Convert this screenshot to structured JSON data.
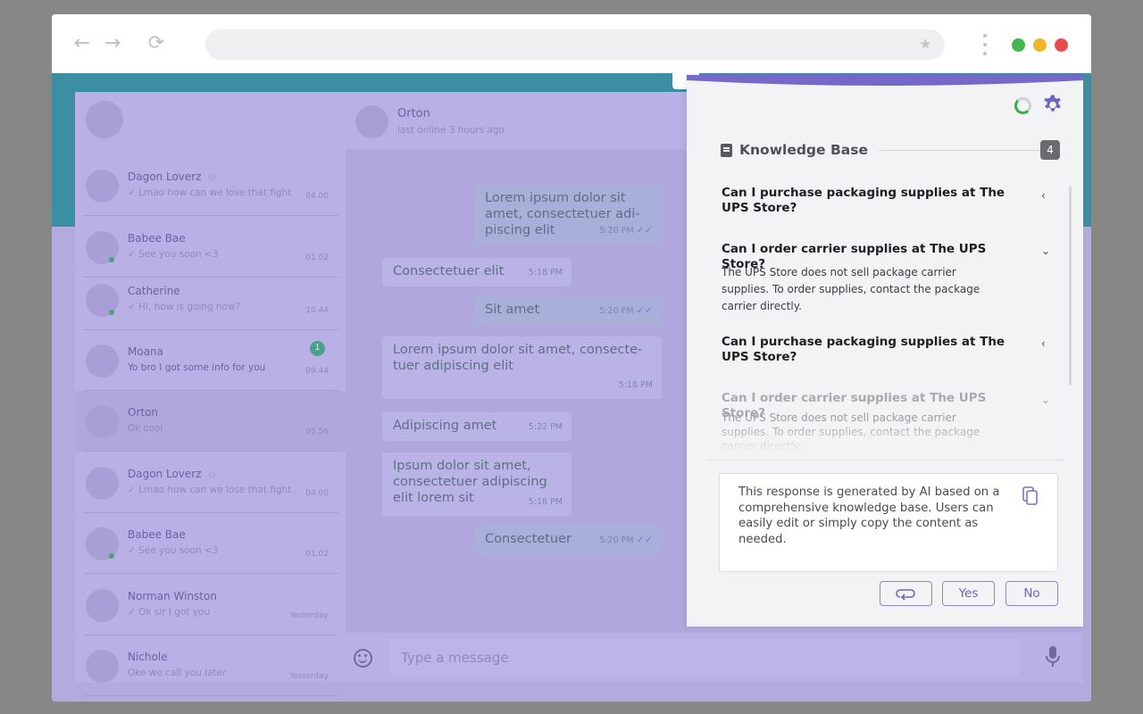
{
  "browser": {
    "back_glyph": "←",
    "forward_glyph": "→",
    "reload_glyph": "⟳",
    "star_glyph": "★",
    "traffic_lights": [
      "#41b84c",
      "#f1b52a",
      "#ea4a4e"
    ]
  },
  "chat_list": {
    "items": [
      {
        "name": "Dagon Loverz",
        "group": true,
        "message": "✓ Lmao how can we lose that fight",
        "time": "04.00",
        "online": false
      },
      {
        "name": "Babee Bae",
        "group": false,
        "message": "✓ See you soon <3",
        "time": "01.02",
        "online": true
      },
      {
        "name": "Catherine",
        "group": false,
        "message": "✓ Hi, how is going now?",
        "time": "10.44",
        "online": true
      },
      {
        "name": "Moana",
        "group": false,
        "message": "Yo bro I got some info for you",
        "time": "09.44",
        "online": false,
        "unread": "1"
      },
      {
        "name": "Orton",
        "group": false,
        "message": "Ok cool",
        "time": "05.56",
        "online": false,
        "active": true
      },
      {
        "name": "Dagon Loverz",
        "group": true,
        "message": "✓ Lmao how can we lose that fight",
        "time": "04.00",
        "online": false
      },
      {
        "name": "Babee Bae",
        "group": false,
        "message": "✓ See you soon <3",
        "time": "01.02",
        "online": true
      },
      {
        "name": "Norman Winston",
        "group": false,
        "message": "✓ Ok sir I got you",
        "time": "Yesterday",
        "online": false
      },
      {
        "name": "Nichole",
        "group": false,
        "message": "Oke we call you later",
        "time": "Yesterday",
        "online": false
      }
    ]
  },
  "conversation": {
    "contact_name": "Orton",
    "contact_status": "last online 3 hours ago",
    "messages": [
      {
        "dir": "out",
        "text": "Lorem ipsum dolor sit amet, consectetuer adi-piscing elit",
        "time": "5:20 PM",
        "read": true
      },
      {
        "dir": "in",
        "text": "Consectetuer elit",
        "time": "5:18 PM"
      },
      {
        "dir": "out",
        "text": "Sit amet",
        "time": "5:20 PM",
        "read": true
      },
      {
        "dir": "in",
        "text": "Lorem ipsum dolor sit amet, consecte-tuer adipiscing elit",
        "time": "5:18 PM"
      },
      {
        "dir": "in",
        "text": "Adipiscing amet",
        "time": "5:22 PM"
      },
      {
        "dir": "in",
        "text": "Ipsum dolor sit amet, consectetuer adipiscing elit lorem sit",
        "time": "5:18 PM"
      },
      {
        "dir": "out",
        "text": "Consectetuer",
        "time": "5:20 PM",
        "read": true
      }
    ],
    "input_placeholder": "Type a message",
    "ticks_glyph": "✓✓"
  },
  "knowledge_base": {
    "title": "Knowledge Base",
    "count": "4",
    "faqs": [
      {
        "question": "Can I purchase packaging supplies at The UPS Store?",
        "answer": "",
        "expanded": false
      },
      {
        "question": "Can I order carrier supplies at The UPS Store?",
        "answer": "The UPS Store does not sell package carrier supplies. To order supplies, contact the package carrier directly.",
        "expanded": true
      },
      {
        "question": "Can I purchase packaging supplies at The UPS Store?",
        "answer": "",
        "expanded": false
      },
      {
        "question": "Can I order carrier supplies at The UPS Store?",
        "answer": "The UPS Store does not sell package carrier supplies. To order supplies, contact the package carrier directly.",
        "expanded": true
      }
    ],
    "response_text": "This response is generated by AI based on a comprehensive knowledge base. Users can easily edit or simply copy the content as needed.",
    "yes_label": "Yes",
    "no_label": "No",
    "chevron_collapsed": "‹",
    "chevron_expanded": "⌄"
  }
}
